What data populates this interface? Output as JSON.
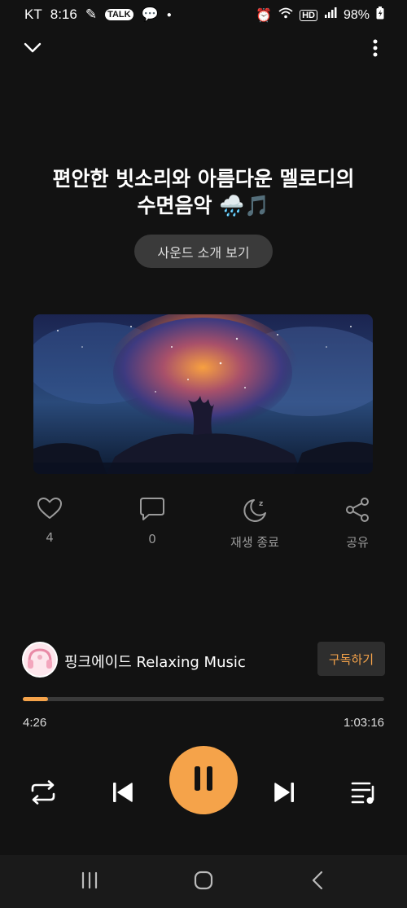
{
  "status_bar": {
    "carrier": "KT",
    "time": "8:16",
    "talk_badge": "TALK",
    "hd_badge": "HD",
    "battery": "98%"
  },
  "track": {
    "title_line1": "편안한 빗소리와 아름다운 멜로디의",
    "title_line2": "수면음악 🌧️🎵",
    "intro_button": "사운드 소개 보기"
  },
  "actions": {
    "like_count": "4",
    "comment_count": "0",
    "sleep_timer_label": "재생 종료",
    "share_label": "공유"
  },
  "channel": {
    "name": "핑크에이드 Relaxing Music",
    "subscribe_label": "구독하기"
  },
  "player": {
    "elapsed": "4:26",
    "duration": "1:03:16",
    "progress_fraction": 0.07,
    "accent_color": "#f5a34a"
  },
  "icons": [
    "chevron-down-icon",
    "more-vertical-icon",
    "heart-icon",
    "comment-icon",
    "moon-timer-icon",
    "share-icon",
    "repeat-icon",
    "previous-icon",
    "pause-icon",
    "next-icon",
    "playlist-icon",
    "recent-apps-icon",
    "home-icon",
    "back-icon"
  ]
}
